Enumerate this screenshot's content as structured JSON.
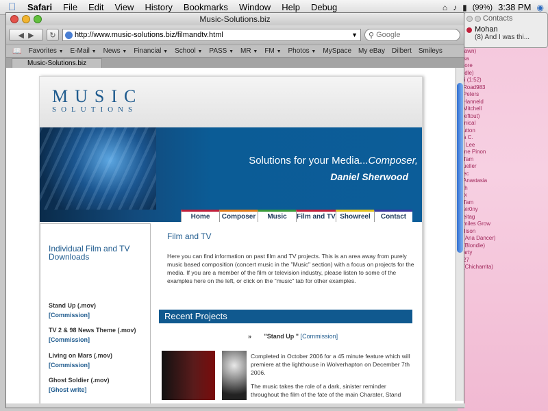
{
  "menubar": {
    "items": [
      "Safari",
      "File",
      "Edit",
      "View",
      "History",
      "Bookmarks",
      "Window",
      "Help",
      "Debug"
    ],
    "battery": "(99%)",
    "clock": "3:38 PM"
  },
  "contacts": {
    "title": "Contacts",
    "name": "Mohan",
    "message": "(8) And I was thi..."
  },
  "background_texts": [
    "lawn)",
    "sa",
    "tore",
    "Idle)",
    "ii (1:52)",
    "Road983",
    "Peters",
    "Hanneld",
    "Mitchell",
    "leftout)",
    "inical",
    "utton",
    "a C.",
    "i Lee",
    "ine Pinon",
    "Tam",
    "ueller",
    "ec",
    "Anastasia",
    "th",
    "ix",
    "Tam",
    "eir0ny",
    "eitag",
    "miles Grow",
    "ilison",
    "(Ana Dancer)",
    "(Blondie)",
    "arty",
    "27",
    "(Chicharrita)"
  ],
  "window": {
    "title": "Music-Solutions.biz",
    "url": "http://www.music-solutions.biz/filmandtv.html",
    "search_placeholder": "Google",
    "bookmarks": [
      {
        "label": "Favorites",
        "menu": true
      },
      {
        "label": "E-Mail",
        "menu": true
      },
      {
        "label": "News",
        "menu": true
      },
      {
        "label": "Financial",
        "menu": true
      },
      {
        "label": "School",
        "menu": true
      },
      {
        "label": "PASS",
        "menu": true
      },
      {
        "label": "MR",
        "menu": true
      },
      {
        "label": "FM",
        "menu": true
      },
      {
        "label": "Photos",
        "menu": true
      },
      {
        "label": "MySpace",
        "menu": false
      },
      {
        "label": "My eBay",
        "menu": false
      },
      {
        "label": "Dilbert",
        "menu": false
      },
      {
        "label": "Smileys",
        "menu": false
      }
    ],
    "tab": "Music-Solutions.biz"
  },
  "site": {
    "logo_main": "MUSIC",
    "logo_sub": "SOLUTIONS",
    "banner_line1": "Solutions for your Media...",
    "banner_line1_italic": "Composer,",
    "banner_line2": "Daniel Sherwood",
    "nav": [
      {
        "label": "Home",
        "color": "#c0203b"
      },
      {
        "label": "Composer",
        "color": "#e07b1a"
      },
      {
        "label": "Music",
        "color": "#3a9a3a"
      },
      {
        "label": "Film and TV",
        "color": "#c0203b"
      },
      {
        "label": "Showreel",
        "color": "#e0c020"
      },
      {
        "label": "Contact",
        "color": "#3a3aa0"
      }
    ],
    "sidebar": {
      "title": "Individual Film and TV Downloads",
      "downloads": [
        {
          "title": "Stand Up (.mov)",
          "tag": "[Commission]"
        },
        {
          "title": "TV 2 & 98 News Theme (.mov)",
          "tag": "[Commission]"
        },
        {
          "title": "Living on Mars (.mov)",
          "tag": "[Commission]"
        },
        {
          "title": "Ghost Soldier (.mov)",
          "tag": "[Ghost write]"
        }
      ]
    },
    "main": {
      "title": "Film and TV",
      "intro": "Here you can find information on past film and TV projects. This is an area away from purely music based composition (concert music in the \"Music\" section) with a focus on projects for the media. If you are a member of the film or television industry, please listen to some of the examples here on the left, or click on the \"music\" tab for other examples.",
      "section": "Recent Projects",
      "project_bullet": "»",
      "project_title": "\"Stand Up \"",
      "project_tag": "[Commission]",
      "project_p1": "Completed in October 2006 for a 45 minute feature which will premiere at the lighthouse in Wolverhapton on December 7th 2006.",
      "project_p2": "The music takes the role of a dark, sinister reminder throughout the film of the fate of the main Charater, Stand"
    }
  }
}
